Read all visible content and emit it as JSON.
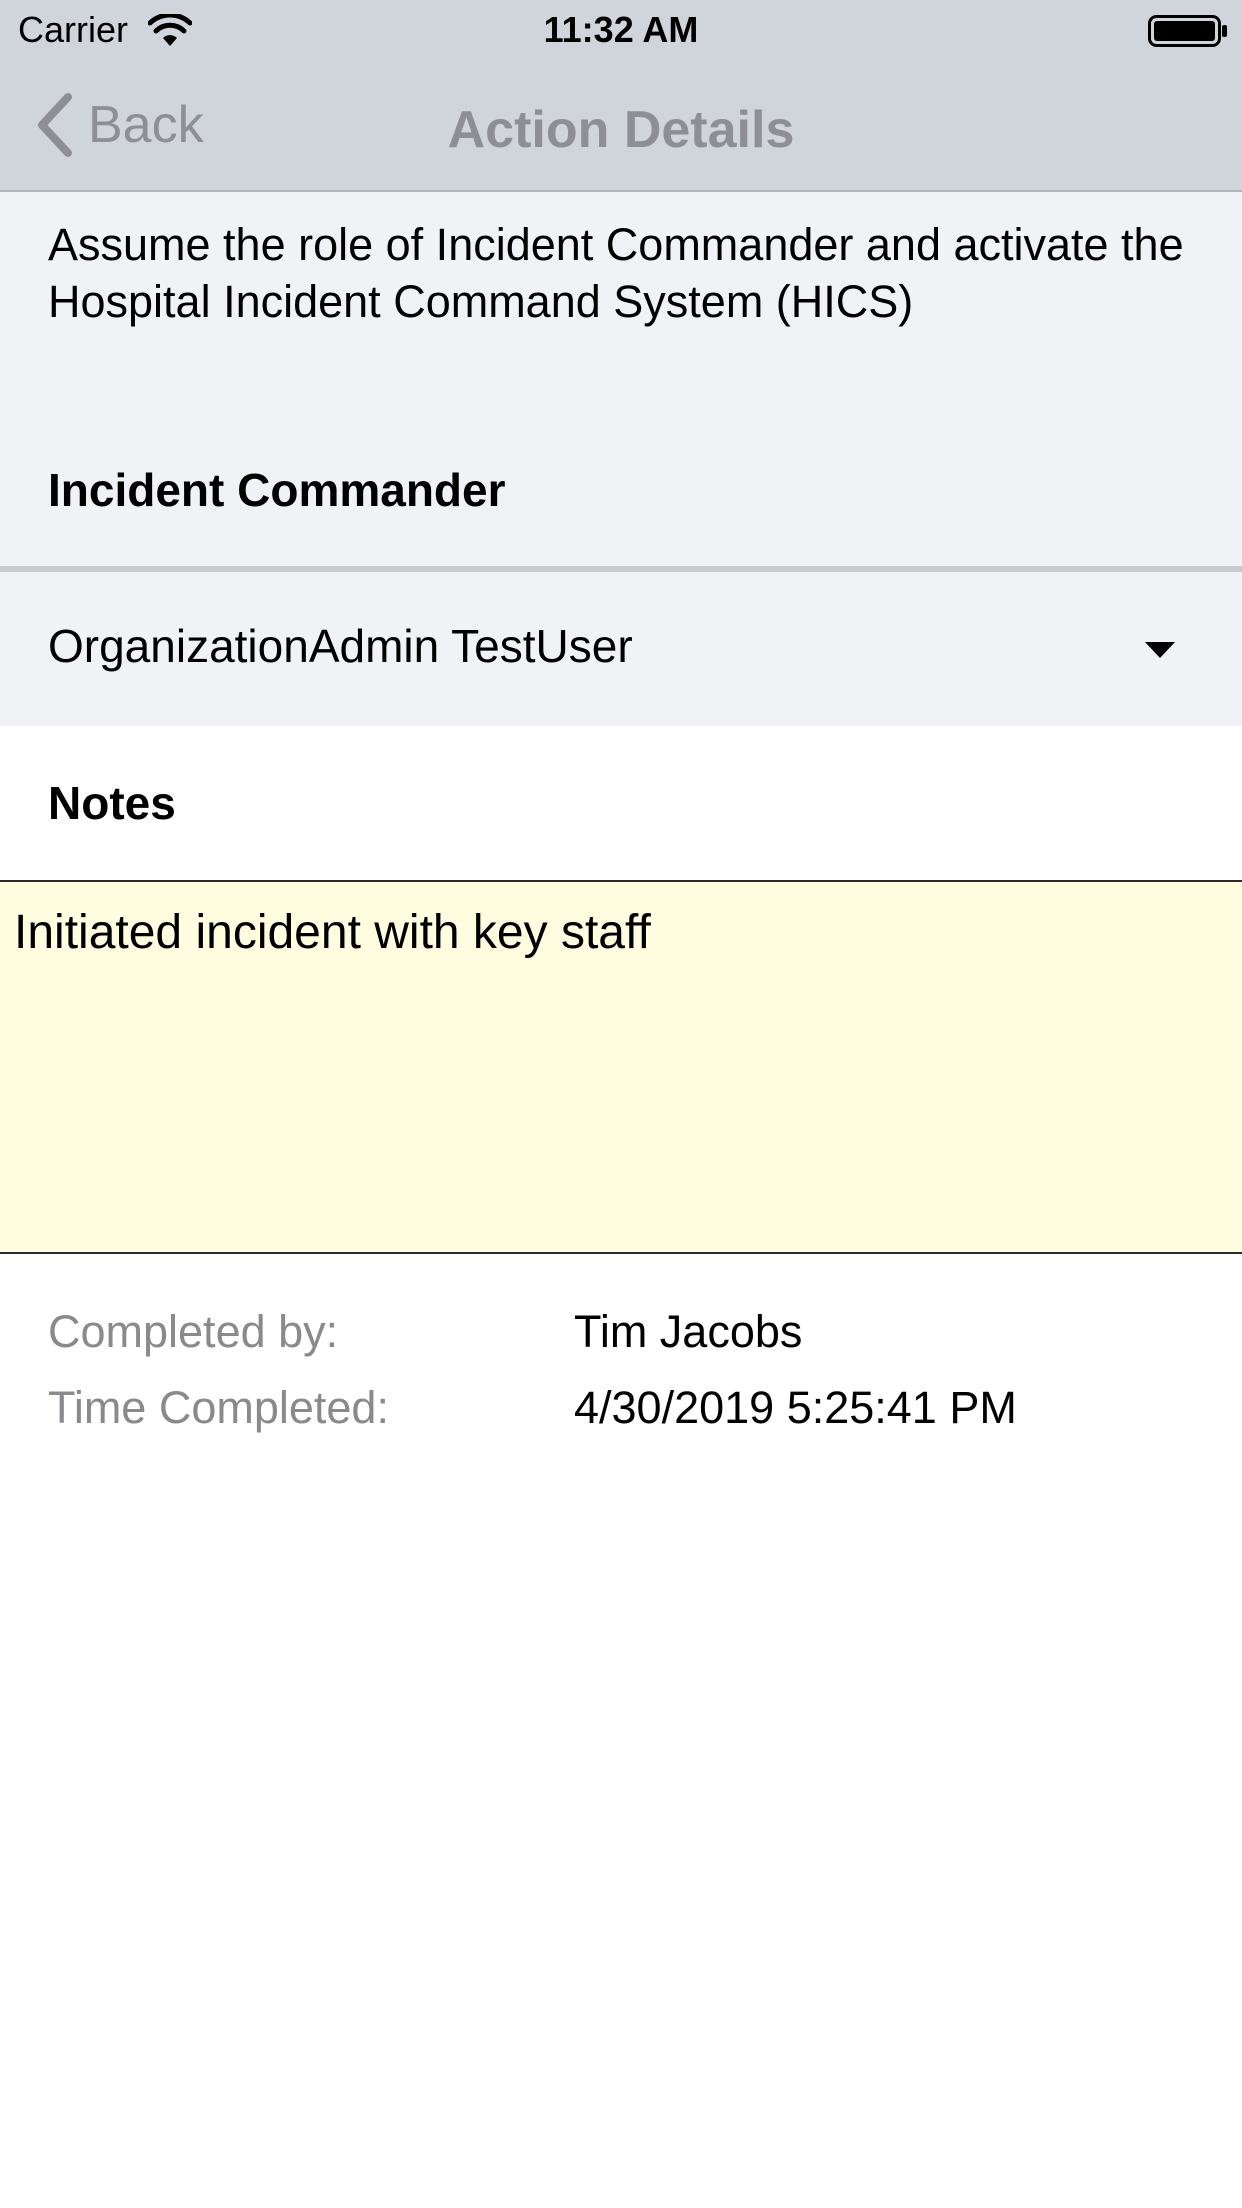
{
  "status_bar": {
    "carrier": "Carrier",
    "time": "11:32 AM"
  },
  "nav": {
    "back_label": "Back",
    "title": "Action Details"
  },
  "action": {
    "description": "Assume the role of Incident Commander and activate the Hospital Incident Command System (HICS)",
    "role": "Incident Commander"
  },
  "assignee": {
    "selected": "OrganizationAdmin TestUser"
  },
  "notes": {
    "label": "Notes",
    "value": "Initiated incident with key staff"
  },
  "completion": {
    "completed_by_label": "Completed by:",
    "completed_by_value": "Tim Jacobs",
    "time_completed_label": "Time Completed:",
    "time_completed_value": "4/30/2019 5:25:41 PM"
  },
  "colors": {
    "nav_background": "#d0d4db",
    "section_background": "#f1f2f6",
    "notes_background": "#fefddf",
    "muted_text": "#8d8f94"
  },
  "icons": {
    "wifi": "wifi-icon",
    "battery": "battery-icon",
    "back": "chevron-left-icon",
    "dropdown": "caret-down-icon"
  }
}
